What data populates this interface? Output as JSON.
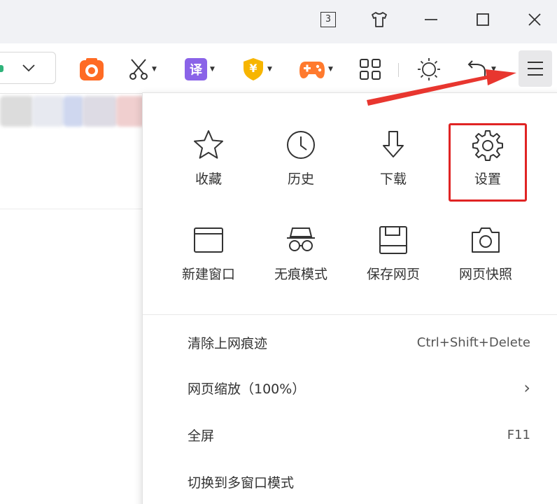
{
  "titlebar": {
    "tab_count": "3",
    "icons": [
      "skin-shirt-icon",
      "minimize-icon",
      "maximize-icon",
      "close-icon"
    ]
  },
  "toolbar": {
    "icons": [
      "chevron-down-icon",
      "screenshot-camera-icon",
      "scissors-icon",
      "translate-icon",
      "security-shield-icon",
      "game-controller-icon",
      "apps-grid-icon",
      "brightness-icon",
      "undo-arrow-icon",
      "hamburger-menu-icon"
    ],
    "translate_label": "译",
    "shield_label": "¥"
  },
  "menu": {
    "grid": [
      {
        "label": "收藏",
        "icon": "star-icon"
      },
      {
        "label": "历史",
        "icon": "clock-icon"
      },
      {
        "label": "下载",
        "icon": "download-icon"
      },
      {
        "label": "设置",
        "icon": "gear-icon"
      },
      {
        "label": "新建窗口",
        "icon": "window-icon"
      },
      {
        "label": "无痕模式",
        "icon": "incognito-icon"
      },
      {
        "label": "保存网页",
        "icon": "save-icon"
      },
      {
        "label": "网页快照",
        "icon": "camera-icon"
      }
    ],
    "rows": [
      {
        "label": "清除上网痕迹",
        "shortcut": "Ctrl+Shift+Delete"
      },
      {
        "label": "网页缩放（100%）",
        "shortcut": "›"
      },
      {
        "label": "全屏",
        "shortcut": "F11"
      },
      {
        "label": "切换到多窗口模式",
        "shortcut": ""
      }
    ]
  },
  "colors": {
    "highlight": "#e02424",
    "titlebar_bg": "#f1f2f5",
    "camera_orange": "#ff6b24",
    "translate_purple": "#8a63e8",
    "shield_gold": "#f7b500",
    "game_orange": "#ff7a2e"
  }
}
